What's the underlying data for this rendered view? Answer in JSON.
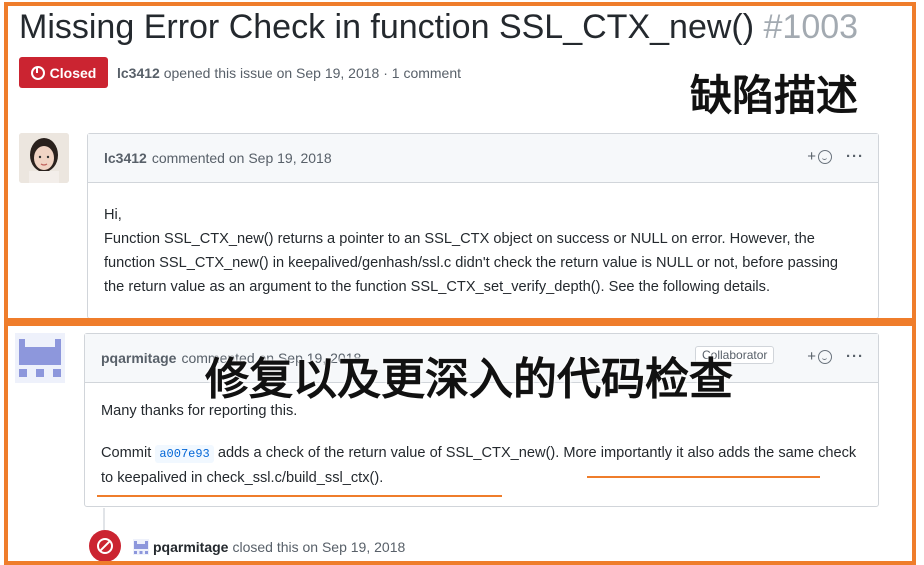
{
  "issue": {
    "title": "Missing Error Check in function SSL_CTX_new()",
    "number": "#1003",
    "state": "Closed",
    "author": "lc3412",
    "meta_text": "opened this issue on Sep 19, 2018 · 1 comment"
  },
  "overlay": {
    "label_top": "缺陷描述",
    "label_bottom": "修复以及更深入的代码检查",
    "accent_color": "#ef7d2b"
  },
  "comment1": {
    "author": "lc3412",
    "meta": "commented on Sep 19, 2018",
    "add_reaction": "+",
    "more": "···",
    "body": [
      "Hi,",
      "Function SSL_CTX_new() returns a pointer to an SSL_CTX object on success or NULL on error. However, the function SSL_CTX_new() in keepalived/genhash/ssl.c didn't check the return value is NULL or not, before passing the return value as an argument to the function SSL_CTX_set_verify_depth(). See the following details."
    ]
  },
  "comment2": {
    "author": "pqarmitage",
    "meta": "commented on Sep 19, 2018",
    "badge": "Collaborator",
    "add_reaction": "+",
    "more": "···",
    "line1": "Many thanks for reporting this.",
    "commit_prefix": "Commit",
    "commit_sha": "a007e93",
    "commit_rest": "adds a check of the return value of SSL_CTX_new(). More importantly it also adds the same check to keepalived in check_ssl.c/build_ssl_ctx()."
  },
  "event": {
    "actor": "pqarmitage",
    "text": "closed this on Sep 19, 2018"
  },
  "colors": {
    "closed_red": "#cb2431",
    "link_blue": "#0366d6"
  }
}
